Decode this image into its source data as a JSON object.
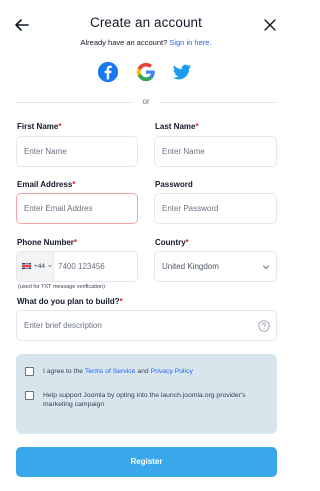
{
  "header": {
    "title": "Create an account",
    "back_icon": "arrow-left-icon",
    "close_icon": "close-icon"
  },
  "signin": {
    "prompt": "Already have an account?",
    "link_label": "Sign in here."
  },
  "social": {
    "facebook_icon": "facebook-icon",
    "google_icon": "google-icon",
    "twitter_icon": "twitter-icon"
  },
  "divider": {
    "label": "or"
  },
  "form": {
    "first_name": {
      "label": "First Name",
      "placeholder": "Enter Name"
    },
    "last_name": {
      "label": "Last Name",
      "placeholder": "Enter Name"
    },
    "email": {
      "label": "Email Address",
      "placeholder": "Enter Email Addres"
    },
    "password": {
      "label": "Password",
      "placeholder": "Enter Password"
    },
    "phone": {
      "label": "Phone Number",
      "country_code": "+44",
      "placeholder": "7400 123456",
      "hint": "(used for TXT message verification)"
    },
    "country": {
      "label": "Country",
      "value": "United Kingdom"
    },
    "plan": {
      "label": "What do you plan to build?",
      "placeholder": "Enter brief description"
    },
    "required_mark": "*"
  },
  "consent": {
    "terms_prefix": "I agree to the",
    "terms_link": "Terms of Service",
    "terms_and": "and",
    "privacy_link": "Privacy Policy",
    "marketing_text": "Help support Joomla by opting into the launch.joomla.org provider's marketing campaign"
  },
  "actions": {
    "register_label": "Register"
  },
  "colors": {
    "accent": "#38a8ea",
    "link": "#2563eb",
    "required": "#dc2626",
    "consent_bg": "#d7e6ed",
    "facebook": "#1877f2",
    "twitter": "#1d9bf0"
  }
}
